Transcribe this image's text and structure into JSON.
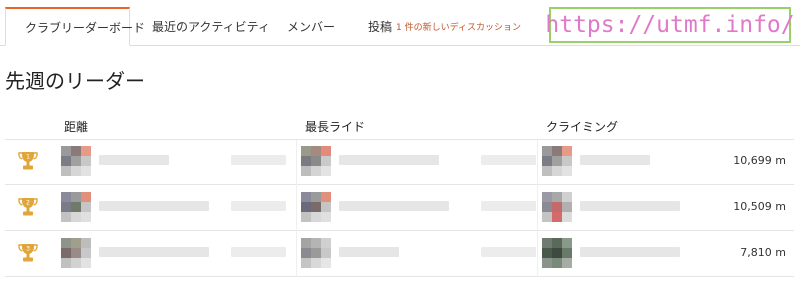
{
  "tabs": [
    {
      "label": "クラブリーダーボード"
    },
    {
      "label": "最近のアクティビティ"
    },
    {
      "label": "メンバー"
    },
    {
      "label": "投稿",
      "note": "1 件の新しいディスカッション"
    }
  ],
  "watermark": "https://utmf.info/",
  "section_title": "先週のリーダー",
  "columns": [
    "距離",
    "最長ライド",
    "クライミング"
  ],
  "rows": [
    {
      "rank": "1",
      "value": "10,699 m"
    },
    {
      "rank": "2",
      "value": "10,509 m"
    },
    {
      "rank": "3",
      "value": "7,810 m"
    }
  ],
  "colors": {
    "accent": "#e8642a",
    "trophy": "#e0a63a",
    "watermark_text": "#e07ac8",
    "watermark_border": "#9ad06c"
  }
}
